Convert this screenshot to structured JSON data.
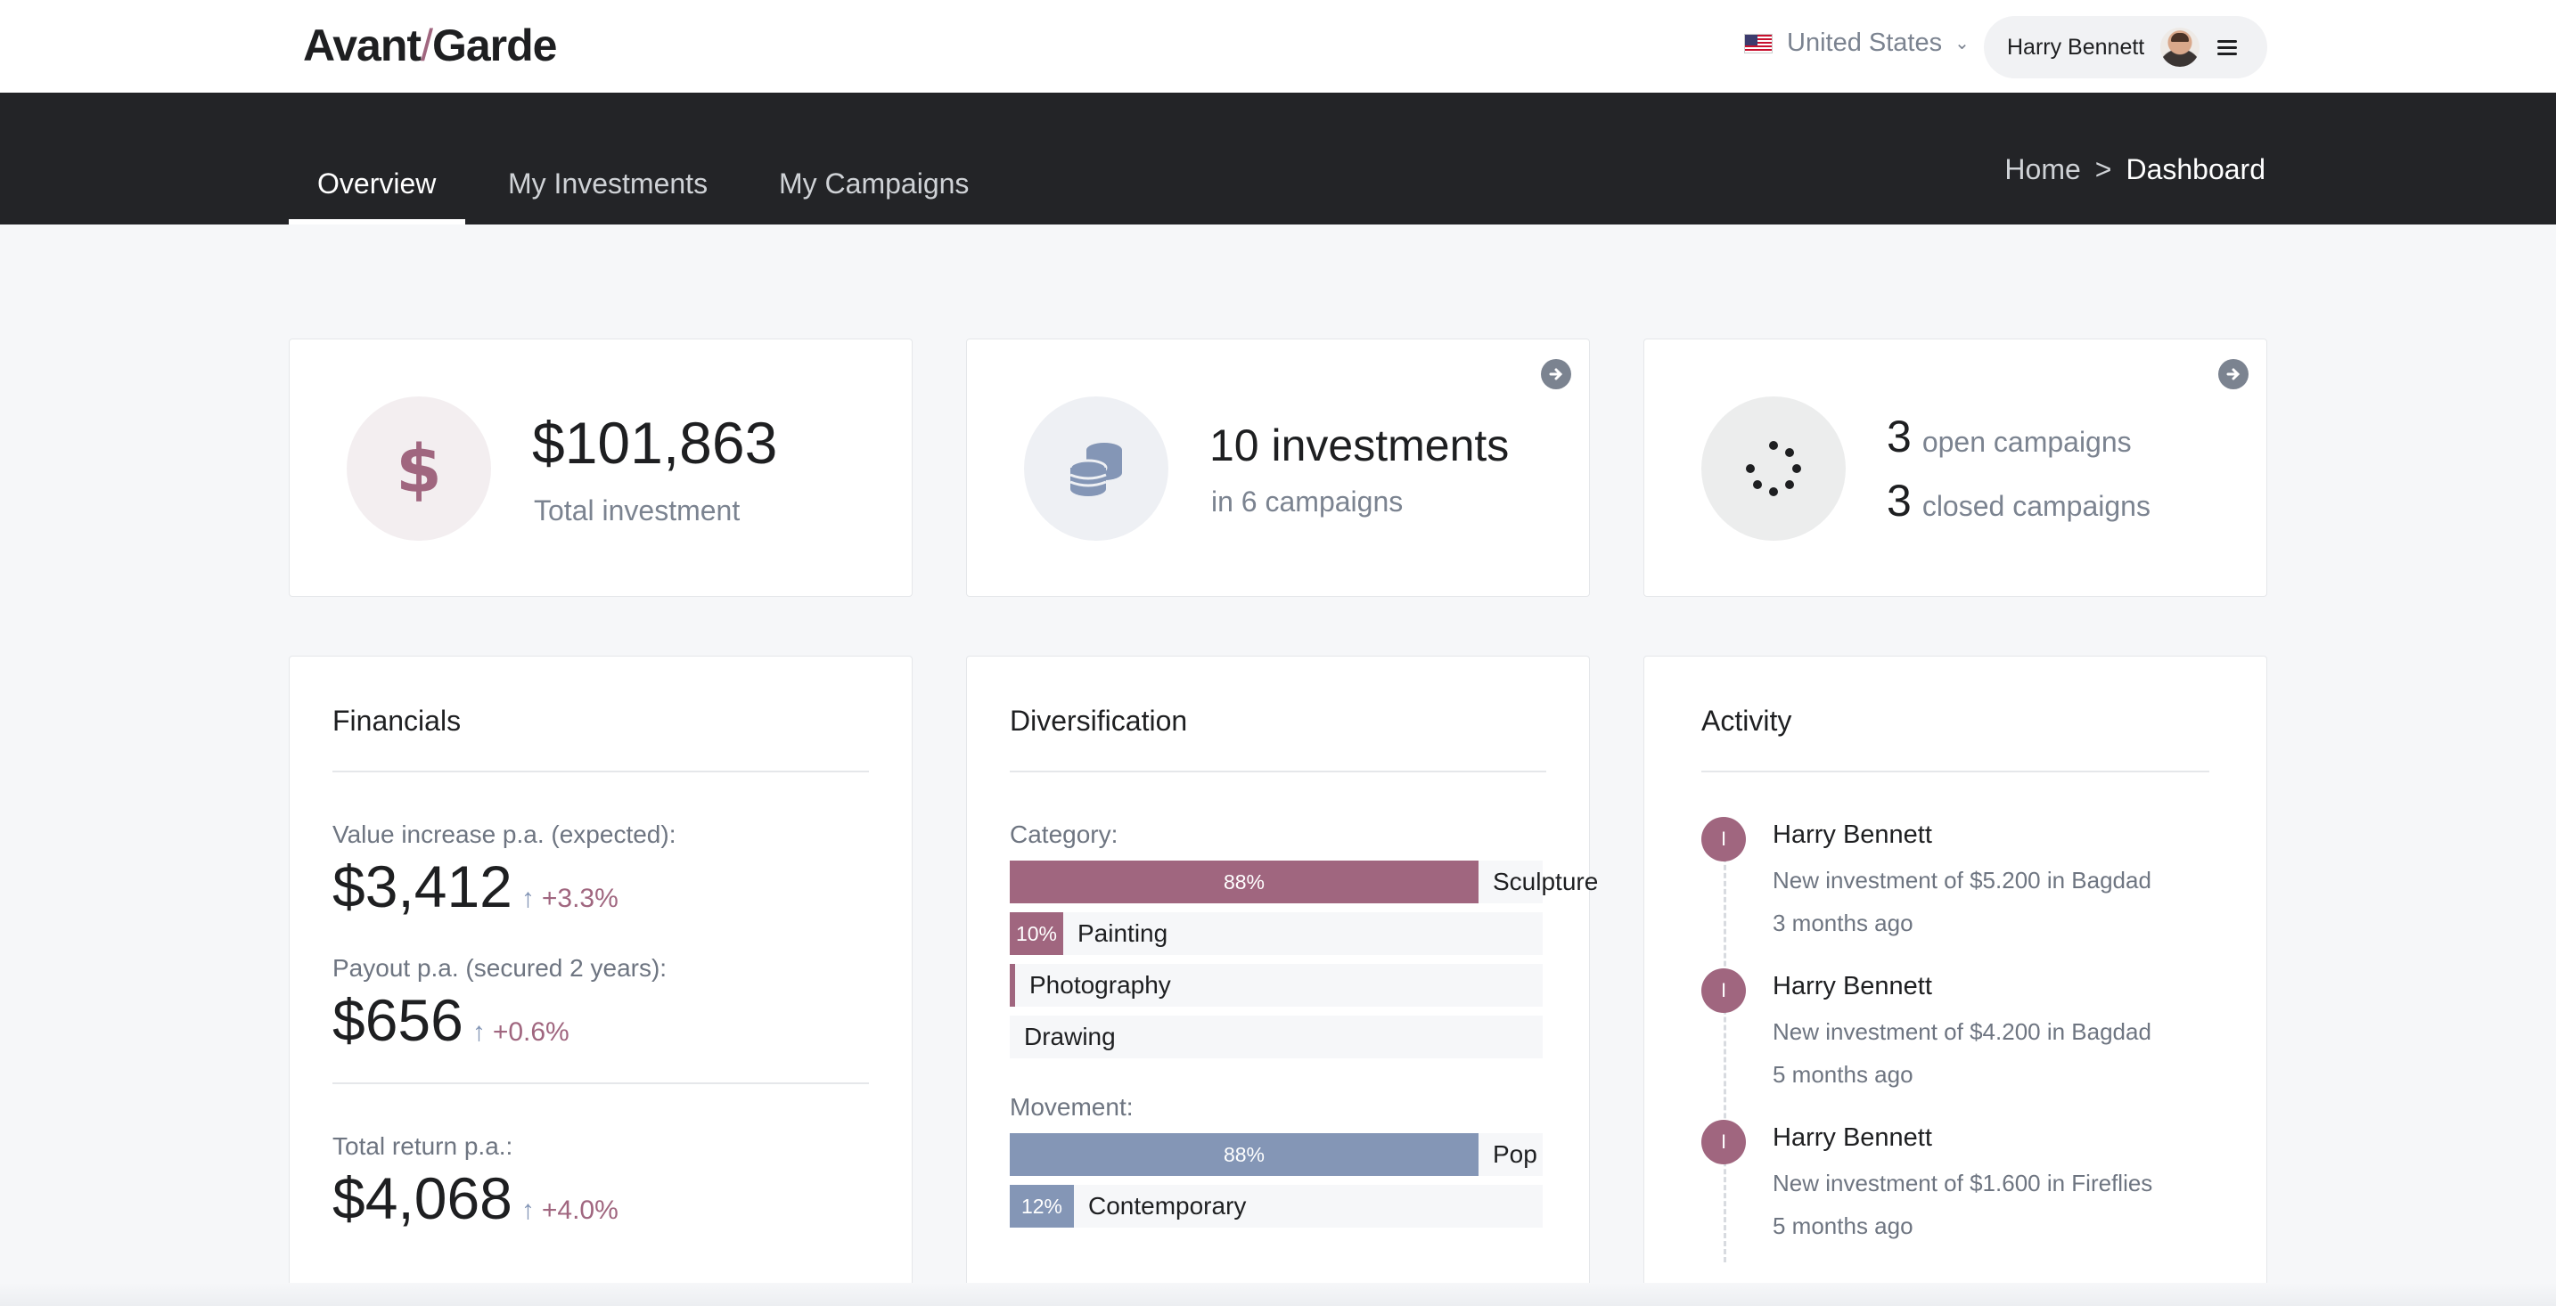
{
  "header": {
    "logo_left": "Avant",
    "logo_slash": "/",
    "logo_right": "Garde",
    "country": "United States",
    "user_name": "Harry Bennett"
  },
  "nav": {
    "tabs": [
      {
        "label": "Overview",
        "active": true
      },
      {
        "label": "My Investments",
        "active": false
      },
      {
        "label": "My Campaigns",
        "active": false
      }
    ],
    "breadcrumb": {
      "home": "Home",
      "separator": ">",
      "current": "Dashboard"
    }
  },
  "stats": {
    "total": {
      "value": "$101,863",
      "label": "Total investment",
      "icon": "dollar-icon"
    },
    "investments": {
      "value": "10 investments",
      "label": "in 6 campaigns",
      "icon": "coins-icon"
    },
    "campaigns": {
      "open_count": "3",
      "open_label": "open campaigns",
      "closed_count": "3",
      "closed_label": "closed campaigns",
      "icon": "spinner-icon"
    }
  },
  "financials": {
    "title": "Financials",
    "rows": [
      {
        "label": "Value increase p.a. (expected):",
        "value": "$3,412",
        "change": "+3.3%"
      },
      {
        "label": "Payout p.a. (secured 2 years):",
        "value": "$656",
        "change": "+0.6%"
      },
      {
        "label": "Total return p.a.:",
        "value": "$4,068",
        "change": "+4.0%"
      }
    ]
  },
  "diversification": {
    "title": "Diversification",
    "category_label": "Category:",
    "categories": [
      {
        "name": "Sculpture",
        "percent": 88,
        "pct_label": "88%"
      },
      {
        "name": "Painting",
        "percent": 10,
        "pct_label": "10%"
      },
      {
        "name": "Photography",
        "percent": 1,
        "pct_label": ""
      },
      {
        "name": "Drawing",
        "percent": 0,
        "pct_label": ""
      }
    ],
    "movement_label": "Movement:",
    "movements": [
      {
        "name": "Pop",
        "percent": 88,
        "pct_label": "88%"
      },
      {
        "name": "Contemporary",
        "percent": 12,
        "pct_label": "12%"
      }
    ],
    "colors": {
      "category": "#a0667f",
      "movement": "#8496b6"
    }
  },
  "activity": {
    "title": "Activity",
    "items": [
      {
        "badge": "I",
        "name": "Harry Bennett",
        "desc": "New investment of $5.200 in Bagdad",
        "time": "3 months ago"
      },
      {
        "badge": "I",
        "name": "Harry Bennett",
        "desc": "New investment of $4.200 in Bagdad",
        "time": "5 months ago"
      },
      {
        "badge": "I",
        "name": "Harry Bennett",
        "desc": "New investment of $1.600 in Fireflies",
        "time": "5 months ago"
      }
    ]
  },
  "colors": {
    "accent": "#a0667f",
    "secondary": "#8496b6",
    "nav_bg": "#232427",
    "page_bg": "#f6f7f9"
  }
}
